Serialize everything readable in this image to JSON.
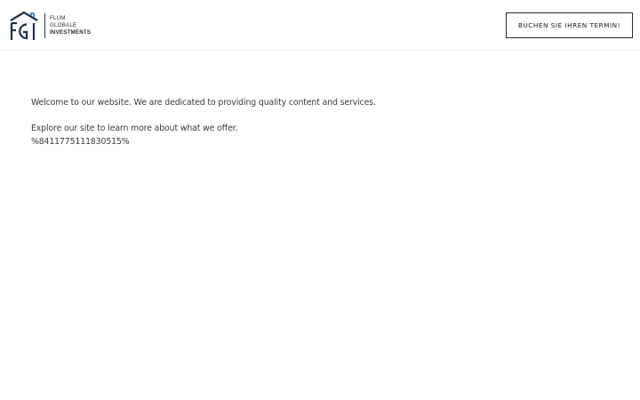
{
  "header": {
    "logo": {
      "mark_text": "FGI",
      "line1": "FLUM",
      "line2": "GLOBALE",
      "line3": "INVESTMENTS",
      "icon": "house-roof-icon"
    },
    "cta_label": "BUCHEN SIE IHREN TERMIN!"
  },
  "main": {
    "paragraph1": "Welcome to our website. We are dedicated to providing quality content and services.",
    "paragraph2": "Explore our site to learn more about what we offer.",
    "paragraph3": "%8411775111830515%"
  },
  "colors": {
    "logo_navy": "#1f2f46",
    "logo_roof_blue": "#2e6db5",
    "text": "#3a3a3a",
    "button_border": "#2a2a2a"
  }
}
